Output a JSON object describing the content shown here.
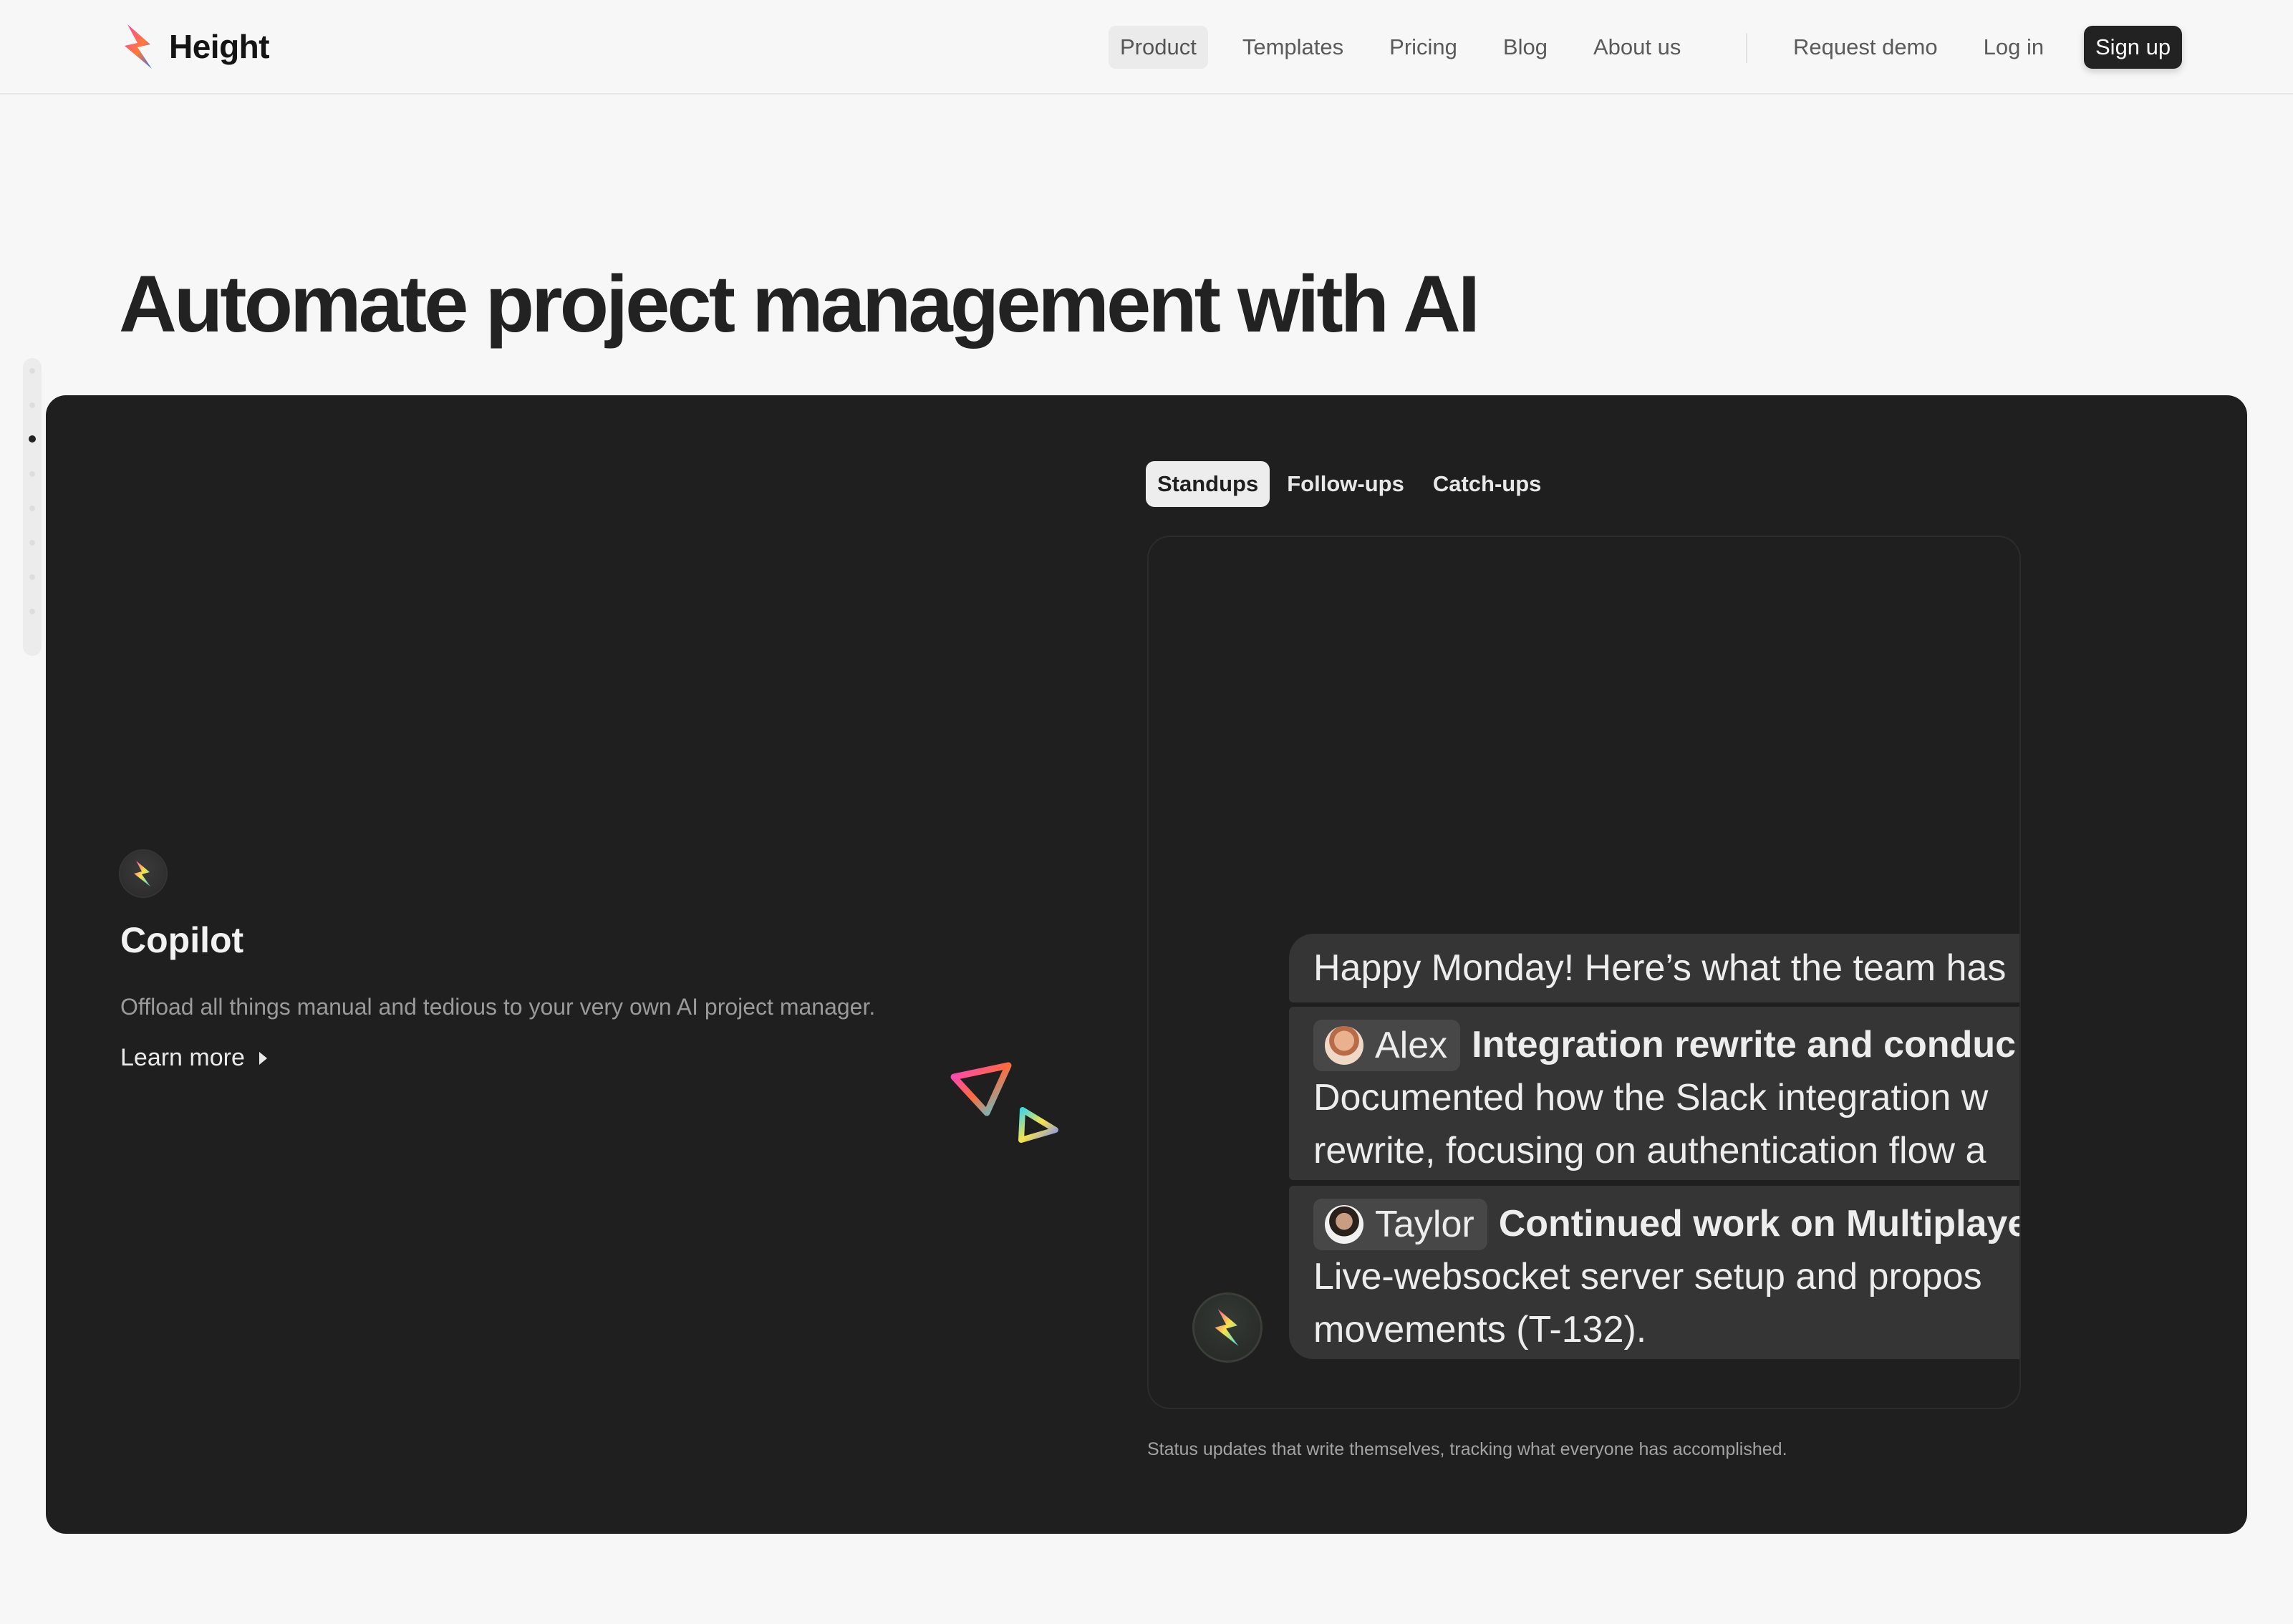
{
  "brand": {
    "name": "Height",
    "logo_icon": "height-bolt-logo"
  },
  "nav": {
    "left_items": [
      {
        "label": "Product",
        "active": true
      },
      {
        "label": "Templates",
        "active": false
      },
      {
        "label": "Pricing",
        "active": false
      },
      {
        "label": "Blog",
        "active": false
      },
      {
        "label": "About us",
        "active": false
      }
    ],
    "right_items": [
      {
        "label": "Request demo"
      },
      {
        "label": "Log in"
      }
    ],
    "signup_label": "Sign up"
  },
  "hero": {
    "headline": "Automate project management with AI"
  },
  "side_nav": {
    "dot_count": 8,
    "active_index": 2
  },
  "feature": {
    "icon": "copilot-bolt-icon",
    "title": "Copilot",
    "description": "Offload all things manual and tedious to your very own AI project manager.",
    "link_label": "Learn more"
  },
  "tabs": [
    {
      "label": "Standups",
      "active": true
    },
    {
      "label": "Follow-ups",
      "active": false
    },
    {
      "label": "Catch-ups",
      "active": false
    }
  ],
  "standup": {
    "intro": "Happy Monday! Here’s what the team has",
    "updates": [
      {
        "person": "Alex",
        "task": "Integration rewrite and conduc",
        "line1": "Documented how the Slack integration w",
        "line2": "rewrite, focusing on authentication flow a"
      },
      {
        "person": "Taylor",
        "task": "Continued work on Multiplaye",
        "line1": "Live-websocket server setup and propos",
        "line2": "movements (T-132)."
      }
    ]
  },
  "caption": "Status updates that write themselves, tracking what everyone has accomplished.",
  "colors": {
    "page_bg": "#f7f7f7",
    "panel_bg": "#1f1f1f",
    "bubble_bg": "#353535",
    "accent_pink": "#f13bd0",
    "accent_orange": "#ff6a3d",
    "accent_cyan": "#3ed7e8",
    "accent_yellow": "#f7e34a"
  }
}
